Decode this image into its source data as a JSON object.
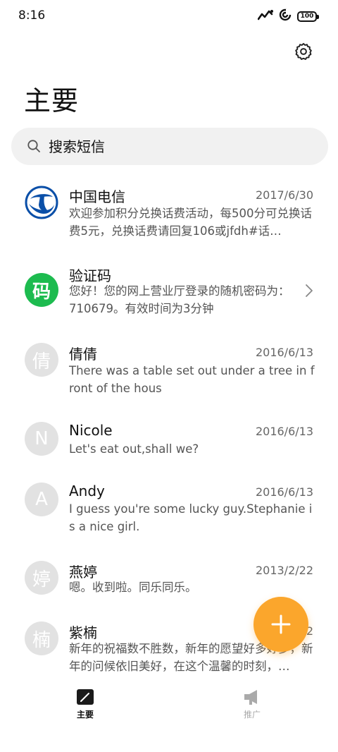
{
  "status": {
    "time": "8:16",
    "battery": "100"
  },
  "header": {
    "title": "主要"
  },
  "search": {
    "placeholder": "搜索短信"
  },
  "messages": [
    {
      "name": "中国电信",
      "date": "2017/6/30",
      "preview": "欢迎参加积分兑换话费活动，每500分可兑换话费5元，兑换话费请回复106或jfdh#话…",
      "avatar": "china-telecom-logo"
    },
    {
      "name": "验证码",
      "date": "",
      "preview": "您好！您的网上营业厅登录的随机密码为：710679。有效时间为3分钟",
      "avatar": "码"
    },
    {
      "name": "倩倩",
      "date": "2016/6/13",
      "preview": "There was a table set out under a tree in front of the hous",
      "avatar": "倩"
    },
    {
      "name": "Nicole",
      "date": "2016/6/13",
      "preview": "Let's eat out,shall we?",
      "avatar": "N"
    },
    {
      "name": "Andy",
      "date": "2016/6/13",
      "preview": "I guess you're some lucky guy.Stephanie is a nice girl.",
      "avatar": "A"
    },
    {
      "name": "燕婷",
      "date": "2013/2/22",
      "preview": "嗯。收到啦。同乐同乐。",
      "avatar": "婷"
    },
    {
      "name": "紫楠",
      "date": "2",
      "preview": "新年的祝福数不胜数，新年的愿望好多好多，新年的问候依旧美好，在这个温馨的时刻，…",
      "avatar": "楠"
    }
  ],
  "bottom_nav": {
    "tabs": [
      {
        "label": "主要"
      },
      {
        "label": "推广"
      }
    ]
  },
  "colors": {
    "fab": "#fba62c",
    "verify_avatar": "#1dbb4f",
    "telecom_blue": "#0a4fa8"
  }
}
